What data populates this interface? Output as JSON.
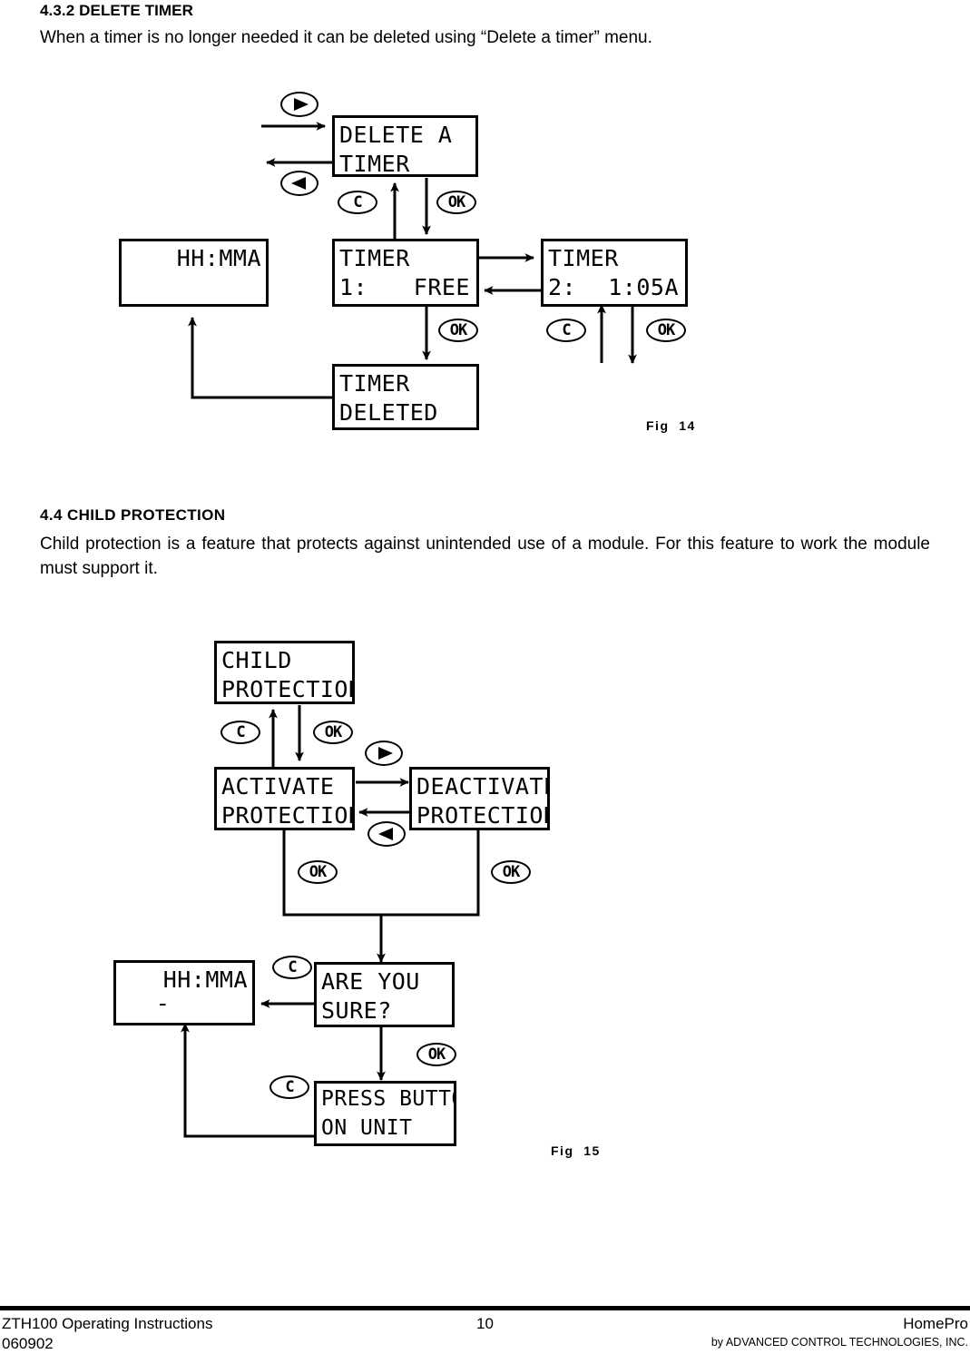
{
  "sections": {
    "delete_timer": {
      "heading": "4.3.2 DELETE TIMER",
      "paragraph": "When a timer is no longer needed it can be deleted using “Delete a timer” menu."
    },
    "child_protection": {
      "heading": "4.4  CHILD  PROTECTION",
      "paragraph": "Child protection is a feature that protects against unintended use of a module. For this feature to work the module must support it."
    }
  },
  "figures": {
    "fig14": {
      "caption": "Fig  14",
      "screens": {
        "delete_a_timer": {
          "line1": "DELETE A",
          "line2": "TIMER"
        },
        "clock": {
          "line1": "HH:MMA",
          "line2": ""
        },
        "timer1_free": {
          "line1": "TIMER",
          "line2_left": "1:",
          "line2_right": "FREE"
        },
        "timer2_time": {
          "line1": "TIMER",
          "line2_left": "2:",
          "line2_right": "1:05A"
        },
        "timer_deleted": {
          "line1": "TIMER",
          "line2": "DELETED"
        }
      },
      "keys": {
        "nav_right": "▶",
        "nav_left": "◀",
        "cancel": "C",
        "ok": "OK"
      }
    },
    "fig15": {
      "caption": "Fig  15",
      "screens": {
        "child_protection": {
          "line1": "CHILD",
          "line2": "PROTECTION"
        },
        "activate_protection": {
          "line1": "ACTIVATE",
          "line2": "PROTECTION"
        },
        "deactivate_protection": {
          "line1": "DEACTIVATE",
          "line2": "PROTECTION"
        },
        "are_you_sure": {
          "line1": "ARE YOU",
          "line2": "SURE?"
        },
        "clock": {
          "line1": "HH:MMA",
          "line2": "-"
        },
        "press_button_on_unit": {
          "line1": "PRESS BUTTON",
          "line2": "ON UNIT"
        }
      },
      "keys": {
        "nav_right": "▶",
        "nav_left": "◀",
        "cancel": "C",
        "ok": "OK"
      }
    }
  },
  "footer": {
    "left_line1": "ZTH100 Operating Instructions",
    "left_line2": "060902",
    "page_number": "10",
    "brand": "HomePro",
    "company": "by ADVANCED CONTROL TECHNOLOGIES, INC."
  }
}
